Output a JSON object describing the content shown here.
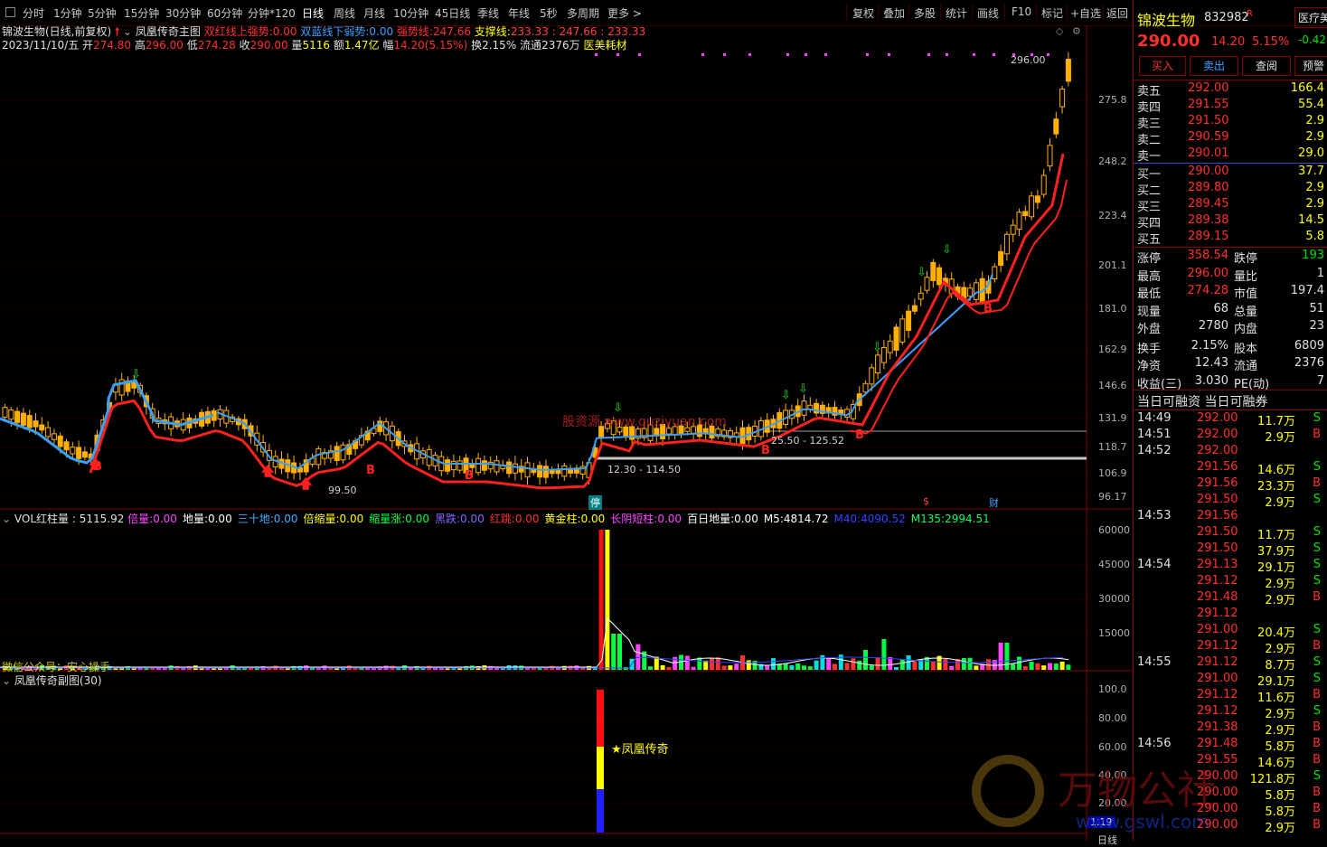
{
  "toolbar": {
    "periods": [
      "分时",
      "1分钟",
      "5分钟",
      "15分钟",
      "30分钟",
      "60分钟",
      "分钟*120",
      "日线",
      "周线",
      "月线",
      "10分钟",
      "45日线",
      "季线",
      "年线",
      "5秒",
      "多周期",
      "更多 >"
    ],
    "active_period": "日线",
    "right_tools": [
      "复权",
      "叠加",
      "多股",
      "统计",
      "画线",
      "F10",
      "标记",
      "+自选",
      "返回"
    ]
  },
  "chart_header": {
    "title": "锦波生物(日线,前复权)",
    "indicator_name": "凤凰传奇主图",
    "ind1_label": "双红线上强势:",
    "ind1_value": "0.00",
    "ind2_label": "双蓝线下弱势:",
    "ind2_value": "0.00",
    "ind3_label": "强势线:",
    "ind3_value": "247.66",
    "ind4_label": "支撑线:",
    "ind4_value": "233.33 : 247.66 : 233.33",
    "date": "2023/11/10/五",
    "open_label": "开",
    "open": "274.80",
    "high_label": "高",
    "high": "296.00",
    "low_label": "低",
    "low": "274.28",
    "close_label": "收",
    "close": "290.00",
    "vol_label": "量",
    "vol": "5116",
    "amount_label": "额",
    "amount": "1.47亿",
    "range_label": "幅",
    "range": "14.20(5.15%)",
    "turnover_label": "换",
    "turnover": "2.15%",
    "float_label": "流通",
    "float": "2376万",
    "sector": "医美耗材"
  },
  "price_axis": [
    "275.8",
    "248.2",
    "223.4",
    "201.1",
    "181.0",
    "162.9",
    "146.6",
    "131.9",
    "118.7",
    "106.9",
    "96.17"
  ],
  "annotations": {
    "high_mark": "296.00",
    "low_mark": "99.50",
    "range1": "12.30 - 114.50",
    "range2": "25.50 - 125.52",
    "watermark": "股资源 www.guziyuan.com",
    "stop_badge": "停",
    "fin_badge": "财",
    "dollar_badge": "$"
  },
  "vol_header": {
    "name": "VOL红柱量",
    "value": ": 5115.92",
    "items": [
      {
        "label": "倍量:",
        "value": "0.00",
        "color": "#ff44ff"
      },
      {
        "label": "地量:",
        "value": "0.00",
        "color": "#ffffff"
      },
      {
        "label": "三十地:",
        "value": "0.00",
        "color": "#44aaff"
      },
      {
        "label": "倍缩量:",
        "value": "0.00",
        "color": "#ffff00"
      },
      {
        "label": "缩量涨:",
        "value": "0.00",
        "color": "#00ff44"
      },
      {
        "label": "黑跌:",
        "value": "0.00",
        "color": "#8866ff"
      },
      {
        "label": "红跳:",
        "value": "0.00",
        "color": "#ff3030"
      },
      {
        "label": "黄金柱:",
        "value": "0.00",
        "color": "#ffff00"
      },
      {
        "label": "长阴短柱:",
        "value": "0.00",
        "color": "#ff44ff"
      },
      {
        "label": "百日地量:",
        "value": "0.00",
        "color": "#ffffff"
      },
      {
        "label": "M5:",
        "value": "4814.72",
        "color": "#ffffff"
      },
      {
        "label": "M40:",
        "value": "4090.52",
        "color": "#3344ff"
      },
      {
        "label": "M135:",
        "value": "2994.51",
        "color": "#00ff66"
      }
    ]
  },
  "vol_axis": [
    "60000",
    "45000",
    "30000",
    "15000"
  ],
  "vol_overlay_text": "微信公众号：安心操手",
  "sub_header": "凤凰传奇副图(30)",
  "sub_axis": [
    "100.0",
    "80.00",
    "60.00",
    "40.00",
    "20.00"
  ],
  "sub_label": "★凤凰传奇",
  "sub_corner": "1.19",
  "logo_text": "万物公社",
  "logo_url_text": "www.gswl.com",
  "side": {
    "name": "锦波生物",
    "code": "832982",
    "code_flag": "R",
    "tab": "医疗美",
    "price": "290.00",
    "change": "14.20",
    "pct": "5.15%",
    "tab_change": "-0.42",
    "buttons": [
      "买入",
      "卖出",
      "查阅",
      "预警"
    ],
    "asks": [
      {
        "label": "卖五",
        "price": "292.00",
        "vol": "166.4"
      },
      {
        "label": "卖四",
        "price": "291.55",
        "vol": "55.4"
      },
      {
        "label": "卖三",
        "price": "291.50",
        "vol": "2.9"
      },
      {
        "label": "卖二",
        "price": "290.59",
        "vol": "2.9"
      },
      {
        "label": "卖一",
        "price": "290.01",
        "vol": "29.0"
      }
    ],
    "bids": [
      {
        "label": "买一",
        "price": "290.00",
        "vol": "37.7"
      },
      {
        "label": "买二",
        "price": "289.80",
        "vol": "2.9"
      },
      {
        "label": "买三",
        "price": "289.45",
        "vol": "2.9"
      },
      {
        "label": "买四",
        "price": "289.38",
        "vol": "14.5"
      },
      {
        "label": "买五",
        "price": "289.15",
        "vol": "5.8"
      }
    ],
    "stats": [
      {
        "l1": "涨停",
        "v1": "358.54",
        "l2": "跌停",
        "v2": "193"
      },
      {
        "l1": "最高",
        "v1": "296.00",
        "l2": "量比",
        "v2": "1"
      },
      {
        "l1": "最低",
        "v1": "274.28",
        "l2": "市值",
        "v2": "197.4"
      },
      {
        "l1": "现量",
        "v1": "68",
        "l2": "总量",
        "v2": "51"
      },
      {
        "l1": "外盘",
        "v1": "2780",
        "l2": "内盘",
        "v2": "23"
      },
      {
        "l1": "换手",
        "v1": "2.15%",
        "l2": "股本",
        "v2": "6809"
      },
      {
        "l1": "净资",
        "v1": "12.43",
        "l2": "流通",
        "v2": "2376"
      },
      {
        "l1": "收益(三)",
        "v1": "3.030",
        "l2": "PE(动)",
        "v2": "7"
      }
    ],
    "margin_label": "当日可融资 当日可融券",
    "ticks": [
      {
        "time": "14:49",
        "price": "292.00",
        "vol": "11.7万",
        "side": "S"
      },
      {
        "time": "14:51",
        "price": "292.00",
        "vol": "2.9万",
        "side": "B"
      },
      {
        "time": "14:52",
        "price": "292.00",
        "vol": "",
        "side": ""
      },
      {
        "time": "",
        "price": "291.56",
        "vol": "14.6万",
        "side": "S"
      },
      {
        "time": "",
        "price": "291.56",
        "vol": "23.3万",
        "side": "B"
      },
      {
        "time": "",
        "price": "291.50",
        "vol": "2.9万",
        "side": "S"
      },
      {
        "time": "14:53",
        "price": "291.56",
        "vol": "",
        "side": ""
      },
      {
        "time": "",
        "price": "291.50",
        "vol": "11.7万",
        "side": "S"
      },
      {
        "time": "",
        "price": "291.50",
        "vol": "37.9万",
        "side": "S"
      },
      {
        "time": "14:54",
        "price": "291.13",
        "vol": "29.1万",
        "side": "S"
      },
      {
        "time": "",
        "price": "291.12",
        "vol": "2.9万",
        "side": "S"
      },
      {
        "time": "",
        "price": "291.48",
        "vol": "2.9万",
        "side": "B"
      },
      {
        "time": "",
        "price": "291.12",
        "vol": "",
        "side": ""
      },
      {
        "time": "",
        "price": "291.00",
        "vol": "20.4万",
        "side": "S"
      },
      {
        "time": "",
        "price": "291.12",
        "vol": "2.9万",
        "side": "B"
      },
      {
        "time": "14:55",
        "price": "291.12",
        "vol": "8.7万",
        "side": "S"
      },
      {
        "time": "",
        "price": "291.00",
        "vol": "29.1万",
        "side": "S"
      },
      {
        "time": "",
        "price": "291.12",
        "vol": "11.6万",
        "side": "B"
      },
      {
        "time": "",
        "price": "291.12",
        "vol": "2.9万",
        "side": "S"
      },
      {
        "time": "",
        "price": "291.38",
        "vol": "2.9万",
        "side": "B"
      },
      {
        "time": "14:56",
        "price": "291.48",
        "vol": "5.8万",
        "side": "B"
      },
      {
        "time": "",
        "price": "291.55",
        "vol": "14.6万",
        "side": "B"
      },
      {
        "time": "",
        "price": "290.00",
        "vol": "121.8万",
        "side": "S"
      },
      {
        "time": "",
        "price": "290.00",
        "vol": "5.8万",
        "side": "B"
      },
      {
        "time": "",
        "price": "290.00",
        "vol": "5.8万",
        "side": "B"
      },
      {
        "time": "",
        "price": "290.00",
        "vol": "2.9万",
        "side": "B"
      }
    ],
    "bottom_tab": "日线"
  },
  "colors": {
    "up": "#ff3030",
    "down": "#00e0e0",
    "candle": "#ffb000",
    "bg": "#000000",
    "grid": "#800000"
  }
}
